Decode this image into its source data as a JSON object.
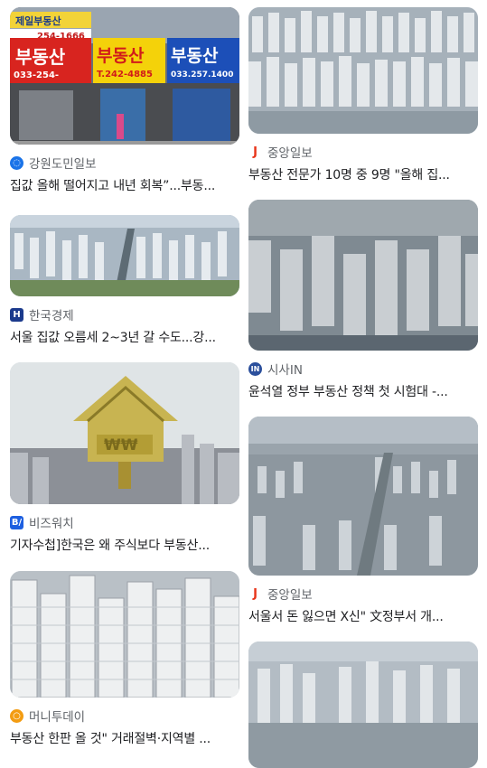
{
  "articles": [
    {
      "source": "강원도민일보",
      "icon": "gangwon-icon",
      "color": "#1a73e8",
      "title": "집값 올해 떨어지고 내년 회복”...부동..."
    },
    {
      "source": "중앙일보",
      "icon": "joongang-icon",
      "color": "#e8351a",
      "title": "부동산 전문가 10명 중 9명 \"올해 집..."
    },
    {
      "source": "한국경제",
      "icon": "hankyung-icon",
      "color": "#1b3a8c",
      "title": "서울 집값 오름세 2~3년 갈 수도...강..."
    },
    {
      "source": "시사IN",
      "icon": "sisain-icon",
      "color": "#2b4f9c",
      "title": "윤석열 정부 부동산 정책 첫 시험대 -..."
    },
    {
      "source": "비즈워치",
      "icon": "bizwatch-icon",
      "color": "#1d5fe0",
      "title": "기자수첩]한국은 왜 주식보다 부동산..."
    },
    {
      "source": "중앙일보",
      "icon": "joongang-icon",
      "color": "#e8351a",
      "title": "서울서 돈 잃으면 X신\" 文정부서 개..."
    },
    {
      "source": "머니투데이",
      "icon": "moneytoday-icon",
      "color": "#f39c12",
      "title": "부동산 한판 올 것\" 거래절벽·지역별 ..."
    }
  ],
  "icon_letters": {
    "hankyung": "H",
    "sisain": "IN",
    "bizwatch": "B/",
    "joongang": "J"
  },
  "signs": {
    "left_top": "부동산",
    "left_phone": "033-254-",
    "mid_big": "부동산",
    "mid_phone": "T.242-4885",
    "right_big": "부동산",
    "right_phone": "033.257.1400",
    "banner": "제일부동산",
    "banner_phone": "254-1666"
  }
}
